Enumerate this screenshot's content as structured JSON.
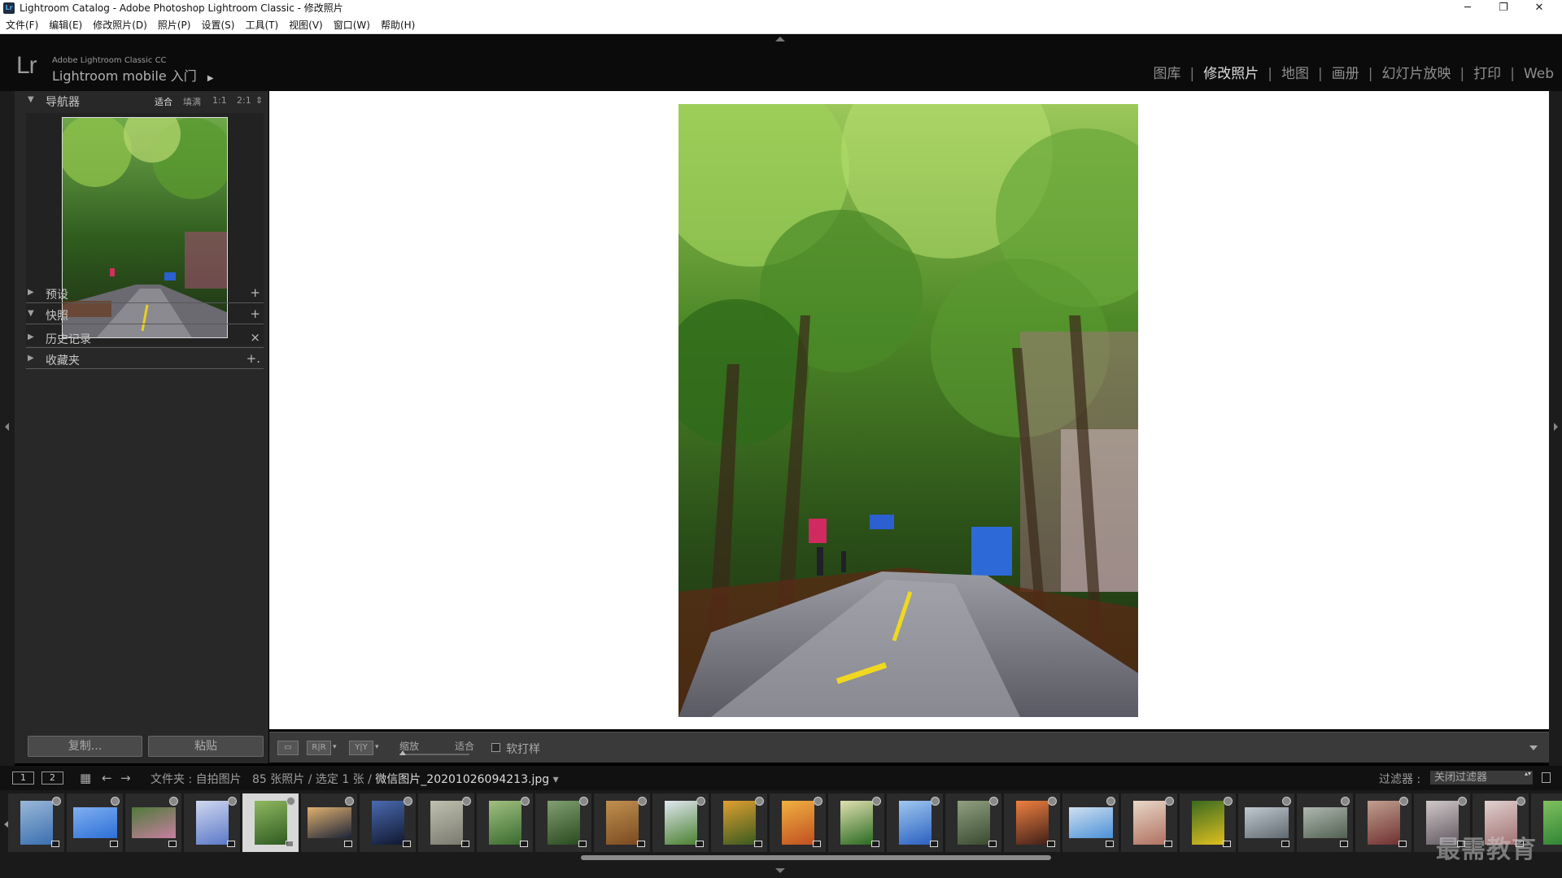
{
  "window": {
    "title": "Lightroom Catalog - Adobe Photoshop Lightroom Classic - 修改照片",
    "icon_text": "Lr",
    "minimize": "─",
    "restore": "❐",
    "close": "✕"
  },
  "menu": [
    "文件(F)",
    "编辑(E)",
    "修改照片(D)",
    "照片(P)",
    "设置(S)",
    "工具(T)",
    "视图(V)",
    "窗口(W)",
    "帮助(H)"
  ],
  "identity": {
    "logo": "Lr",
    "product": "Adobe Lightroom Classic CC",
    "mobile": "Lightroom mobile 入门",
    "play": "▶"
  },
  "modules": [
    {
      "label": "图库",
      "active": false
    },
    {
      "label": "修改照片",
      "active": true
    },
    {
      "label": "地图",
      "active": false
    },
    {
      "label": "画册",
      "active": false
    },
    {
      "label": "幻灯片放映",
      "active": false
    },
    {
      "label": "打印",
      "active": false
    },
    {
      "label": "Web",
      "active": false
    }
  ],
  "module_separator": "|",
  "left_panel": {
    "navigator": {
      "title": "导航器",
      "zoom_options": [
        "适合",
        "填满",
        "1:1",
        "2:1"
      ],
      "zoom_spinner": "⇕",
      "triangle": "▼"
    },
    "sections": [
      {
        "title": "预设",
        "triangle": "▶",
        "action": "+"
      },
      {
        "title": "快照",
        "triangle": "▼",
        "action": "+"
      },
      {
        "title": "历史记录",
        "triangle": "▶",
        "action": "×"
      },
      {
        "title": "收藏夹",
        "triangle": "▶",
        "action": "+."
      }
    ],
    "copy_button": "复制...",
    "paste_button": "粘贴"
  },
  "toolbar": {
    "view_loupe": "▭",
    "view_before_after": "R|R",
    "view_yy": "Y|Y",
    "zoom_label": "缩放",
    "zoom_value": "适合",
    "soft_proof_label": "软打样",
    "soft_proof_checked": false
  },
  "filmstrip_header": {
    "page1": "1",
    "page2": "2",
    "grid_icon": "▦",
    "back_icon": "←",
    "forward_icon": "→",
    "source_prefix": "文件夹 : 自拍图片",
    "count": "85 张照片 / 选定 1 张 /",
    "filename": "微信图片_20201026094213.jpg",
    "filename_dropdown": "▾",
    "filter_label": "过滤器 :",
    "filter_value": "关闭过滤器"
  },
  "filmstrip": {
    "selected_index": 4,
    "thumbs": [
      {
        "colors": [
          "#3a6fb0",
          "#9ab8d8"
        ],
        "portrait": true
      },
      {
        "colors": [
          "#2d6fd8",
          "#7fb0f0"
        ],
        "portrait": false
      },
      {
        "colors": [
          "#c77fa0",
          "#4f7a3a"
        ],
        "portrait": false
      },
      {
        "colors": [
          "#5b78c8",
          "#d0d8f0"
        ],
        "portrait": true
      },
      {
        "colors": [
          "#2f5a20",
          "#8fb860"
        ],
        "portrait": true
      },
      {
        "colors": [
          "#1c2436",
          "#e0b070"
        ],
        "portrait": false
      },
      {
        "colors": [
          "#101830",
          "#4a6ab0"
        ],
        "portrait": true
      },
      {
        "colors": [
          "#7a7a70",
          "#c0c0b0"
        ],
        "portrait": true
      },
      {
        "colors": [
          "#3a6a30",
          "#a0c080"
        ],
        "portrait": true
      },
      {
        "colors": [
          "#2a4a20",
          "#80a070"
        ],
        "portrait": true
      },
      {
        "colors": [
          "#7a4a20",
          "#c09050"
        ],
        "portrait": true
      },
      {
        "colors": [
          "#4a8030",
          "#e0e8f0"
        ],
        "portrait": true
      },
      {
        "colors": [
          "#3a5a20",
          "#e0a030"
        ],
        "portrait": true
      },
      {
        "colors": [
          "#c05020",
          "#f0b040"
        ],
        "portrait": true
      },
      {
        "colors": [
          "#2a6a20",
          "#e0e0b0"
        ],
        "portrait": true
      },
      {
        "colors": [
          "#2a60c0",
          "#a0c8f0"
        ],
        "portrait": true
      },
      {
        "colors": [
          "#3a4a30",
          "#90a080"
        ],
        "portrait": true
      },
      {
        "colors": [
          "#402018",
          "#f08040"
        ],
        "portrait": true
      },
      {
        "colors": [
          "#4a90d8",
          "#d0e0f0"
        ],
        "portrait": false
      },
      {
        "colors": [
          "#b07060",
          "#e8d8c8"
        ],
        "portrait": true
      },
      {
        "colors": [
          "#e0c020",
          "#3a6a20"
        ],
        "portrait": true
      },
      {
        "colors": [
          "#606870",
          "#c0c8d0"
        ],
        "portrait": false
      },
      {
        "colors": [
          "#506050",
          "#b0b8b0"
        ],
        "portrait": false
      },
      {
        "colors": [
          "#703030",
          "#c0a090"
        ],
        "portrait": true
      },
      {
        "colors": [
          "#605860",
          "#d0c8c8"
        ],
        "portrait": true
      },
      {
        "colors": [
          "#a07070",
          "#e0d0d0"
        ],
        "portrait": true
      },
      {
        "colors": [
          "#2a8030",
          "#80c060"
        ],
        "portrait": true
      }
    ]
  },
  "watermark": "最需教育"
}
